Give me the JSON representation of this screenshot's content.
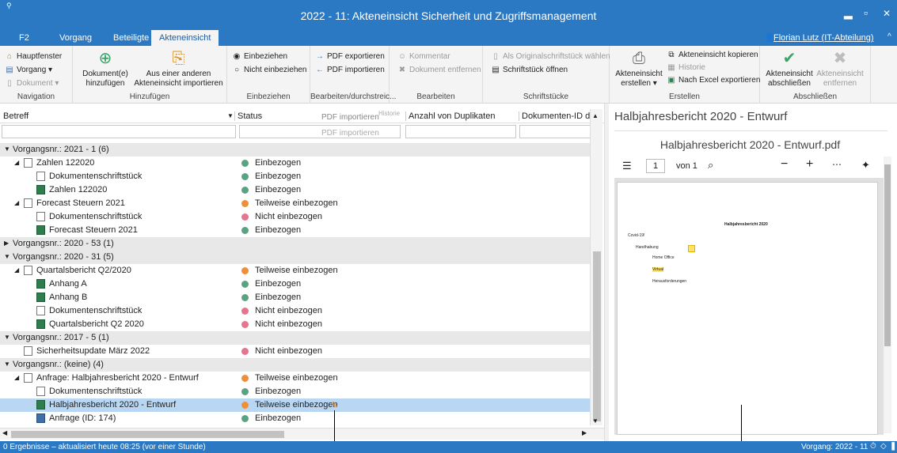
{
  "window": {
    "title": "2022 - 11: Akteneinsicht Sicherheit und Zugriffsmanagement",
    "menu_glyph": "⚲",
    "min": "▂",
    "max": "▫",
    "close": "✕"
  },
  "tabs": [
    "F2",
    "Vorgang",
    "Beteiligte",
    "Akteneinsicht"
  ],
  "user": "Florian Lutz (IT-Abteilung)",
  "ribbon": {
    "nav": {
      "items": [
        "Hauptfenster",
        "Vorgang ▾",
        "Dokument ▾"
      ],
      "label": "Navigation"
    },
    "add": {
      "b1": "Dokument(e) hinzufügen",
      "b2": "Aus einer anderen Akteneinsicht importieren",
      "label": "Hinzufügen"
    },
    "incl": {
      "i1": "Einbeziehen",
      "i2": "Nicht einbeziehen",
      "label": "Einbeziehen"
    },
    "edit": {
      "i1": "PDF exportieren",
      "i2": "PDF importieren",
      "label": "Bearbeiten/durchstreic..."
    },
    "work": {
      "i1": "Kommentar",
      "i2": "Dokument entfernen",
      "label": "Bearbeiten"
    },
    "pieces": {
      "i1": "Als Originalschriftstück wählen",
      "i2": "Schriftstück öffnen",
      "label": "Schriftstücke"
    },
    "create": {
      "b1": "Akteneinsicht erstellen ▾",
      "i1": "Akteneinsicht kopieren",
      "i2": "Historie",
      "i3": "Nach Excel exportieren",
      "label": "Erstellen"
    },
    "close": {
      "b1": "Akteneinsicht abschließen",
      "b2": "Akteneinsicht entfernen",
      "label": "Abschließen"
    }
  },
  "columns": [
    "Betreff",
    "Status",
    "Anzahl von Duplikaten",
    "Dokumenten-ID des"
  ],
  "ghost": {
    "a": "PDF importieren",
    "b": "Historie",
    "c": "PDF importieren"
  },
  "rows": [
    {
      "t": "g",
      "text": "Vorgangsnr.: 2021 - 1 (6)",
      "exp": "▼"
    },
    {
      "t": "d",
      "lvl": 1,
      "icon": "doc",
      "text": "Zahlen 122020",
      "status": "Einbezogen",
      "c": "g",
      "exp": "◢"
    },
    {
      "t": "d",
      "lvl": 2,
      "icon": "doc",
      "text": "Dokumentenschriftstück",
      "status": "Einbezogen",
      "c": "g"
    },
    {
      "t": "d",
      "lvl": 2,
      "icon": "xl",
      "text": "Zahlen 122020",
      "status": "Einbezogen",
      "c": "g"
    },
    {
      "t": "d",
      "lvl": 1,
      "icon": "doc",
      "text": "Forecast Steuern 2021",
      "status": "Teilweise einbezogen",
      "c": "o",
      "exp": "◢"
    },
    {
      "t": "d",
      "lvl": 2,
      "icon": "doc",
      "text": "Dokumentenschriftstück",
      "status": "Nicht einbezogen",
      "c": "p"
    },
    {
      "t": "d",
      "lvl": 2,
      "icon": "xl",
      "text": "Forecast Steuern 2021",
      "status": "Einbezogen",
      "c": "g"
    },
    {
      "t": "g",
      "text": "Vorgangsnr.: 2020 - 53 (1)",
      "exp": "▶"
    },
    {
      "t": "g",
      "text": "Vorgangsnr.: 2020 - 31 (5)",
      "exp": "▼"
    },
    {
      "t": "d",
      "lvl": 1,
      "icon": "doc",
      "text": "Quartalsbericht Q2/2020",
      "status": "Teilweise einbezogen",
      "c": "o",
      "exp": "◢"
    },
    {
      "t": "d",
      "lvl": 2,
      "icon": "xl",
      "text": "Anhang A",
      "status": "Einbezogen",
      "c": "g"
    },
    {
      "t": "d",
      "lvl": 2,
      "icon": "xl",
      "text": "Anhang B",
      "status": "Einbezogen",
      "c": "g"
    },
    {
      "t": "d",
      "lvl": 2,
      "icon": "doc",
      "text": "Dokumentenschriftstück",
      "status": "Nicht einbezogen",
      "c": "p"
    },
    {
      "t": "d",
      "lvl": 2,
      "icon": "xl",
      "text": "Quartalsbericht Q2 2020",
      "status": "Nicht einbezogen",
      "c": "p"
    },
    {
      "t": "g",
      "text": "Vorgangsnr.: 2017 - 5 (1)",
      "exp": "▼"
    },
    {
      "t": "d",
      "lvl": 1,
      "icon": "doc",
      "text": "Sicherheitsupdate März 2022",
      "status": "Nicht einbezogen",
      "c": "p"
    },
    {
      "t": "g",
      "text": "Vorgangsnr.: (keine) (4)",
      "exp": "▼"
    },
    {
      "t": "d",
      "lvl": 1,
      "icon": "doc",
      "text": "Anfrage: Halbjahresbericht 2020 - Entwurf",
      "status": "Teilweise einbezogen",
      "c": "o",
      "exp": "◢"
    },
    {
      "t": "d",
      "lvl": 2,
      "icon": "doc",
      "text": "Dokumentenschriftstück",
      "status": "Einbezogen",
      "c": "g"
    },
    {
      "t": "d",
      "lvl": 2,
      "icon": "xl",
      "text": "Halbjahresbericht 2020 - Entwurf",
      "status": "Teilweise einbezogen",
      "c": "o",
      "sel": true
    },
    {
      "t": "d",
      "lvl": 2,
      "icon": "bl",
      "text": "Anfrage (ID: 174)",
      "status": "Einbezogen",
      "c": "g"
    }
  ],
  "preview": {
    "title": "Halbjahresbericht 2020 - Entwurf",
    "filename": "Halbjahresbericht 2020 - Entwurf.pdf",
    "page": "1",
    "of": "von 1",
    "doc": {
      "heading": "Halbjahresbericht 2020",
      "l1": "Covid-19!",
      "l2": "Handhabung",
      "l3": "Home Office",
      "l4": "Virtual",
      "l5": "Herausforderungen"
    }
  },
  "status": {
    "left": "0 Ergebnisse – aktualisiert heute 08:25 (vor einer Stunde)",
    "right": "Vorgang: 2022 - 11"
  }
}
